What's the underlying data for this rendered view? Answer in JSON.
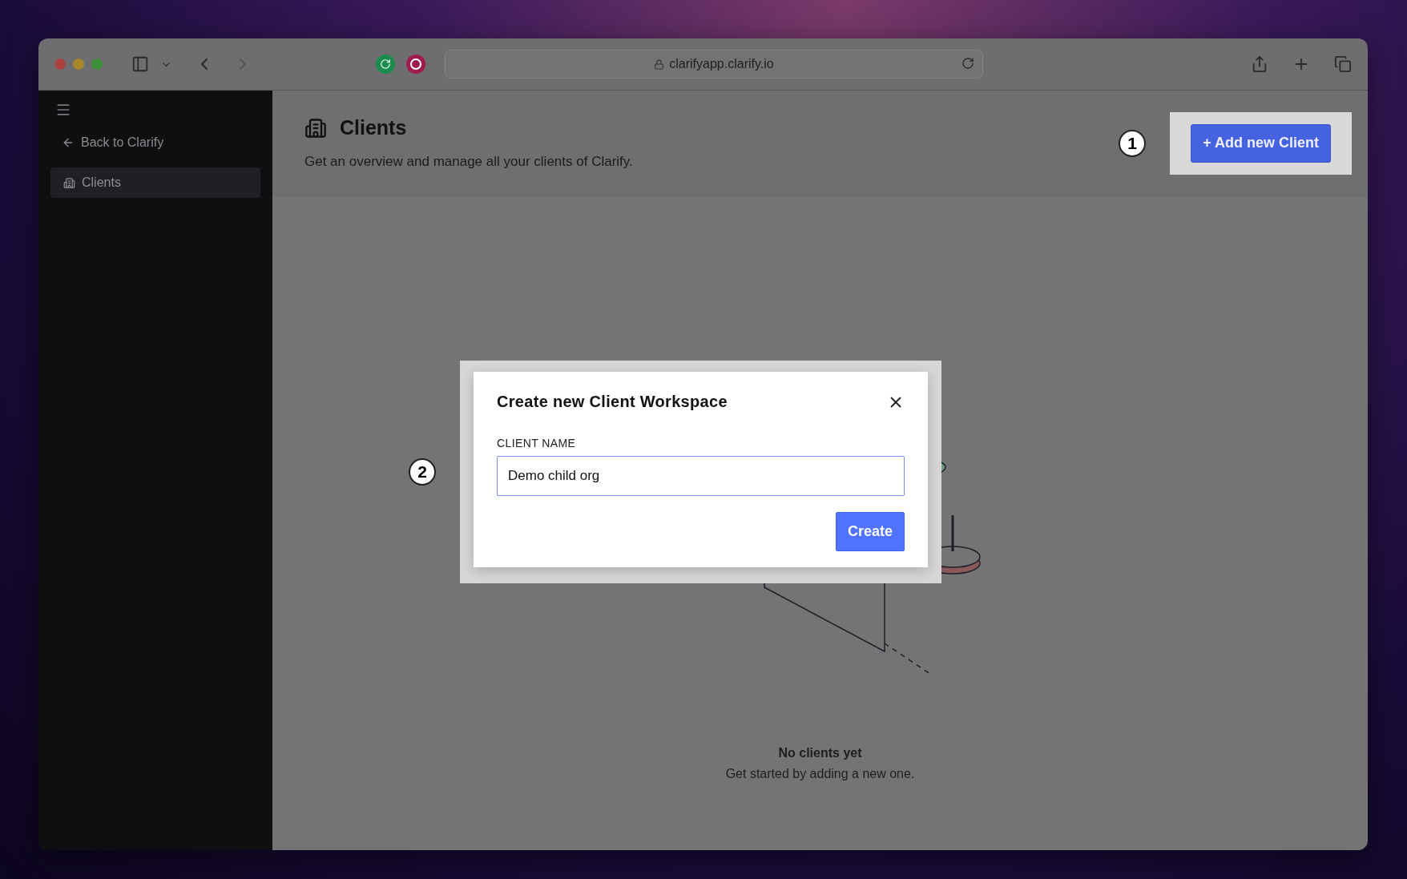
{
  "browser": {
    "url": "clarifyapp.clarify.io"
  },
  "sidebar": {
    "back_link": "Back to Clarify",
    "items": [
      {
        "label": "Clients",
        "selected": true
      }
    ]
  },
  "header": {
    "title": "Clients",
    "subtitle": "Get an overview and manage all your clients of Clarify.",
    "add_button": "+ Add new Client"
  },
  "empty_state": {
    "title": "No clients yet",
    "text": "Get started by adding a new one."
  },
  "dialog": {
    "title": "Create new Client Workspace",
    "field_label": "CLIENT NAME",
    "field_value": "Demo child org",
    "submit": "Create"
  },
  "annotations": [
    {
      "label": "1"
    },
    {
      "label": "2"
    }
  ]
}
